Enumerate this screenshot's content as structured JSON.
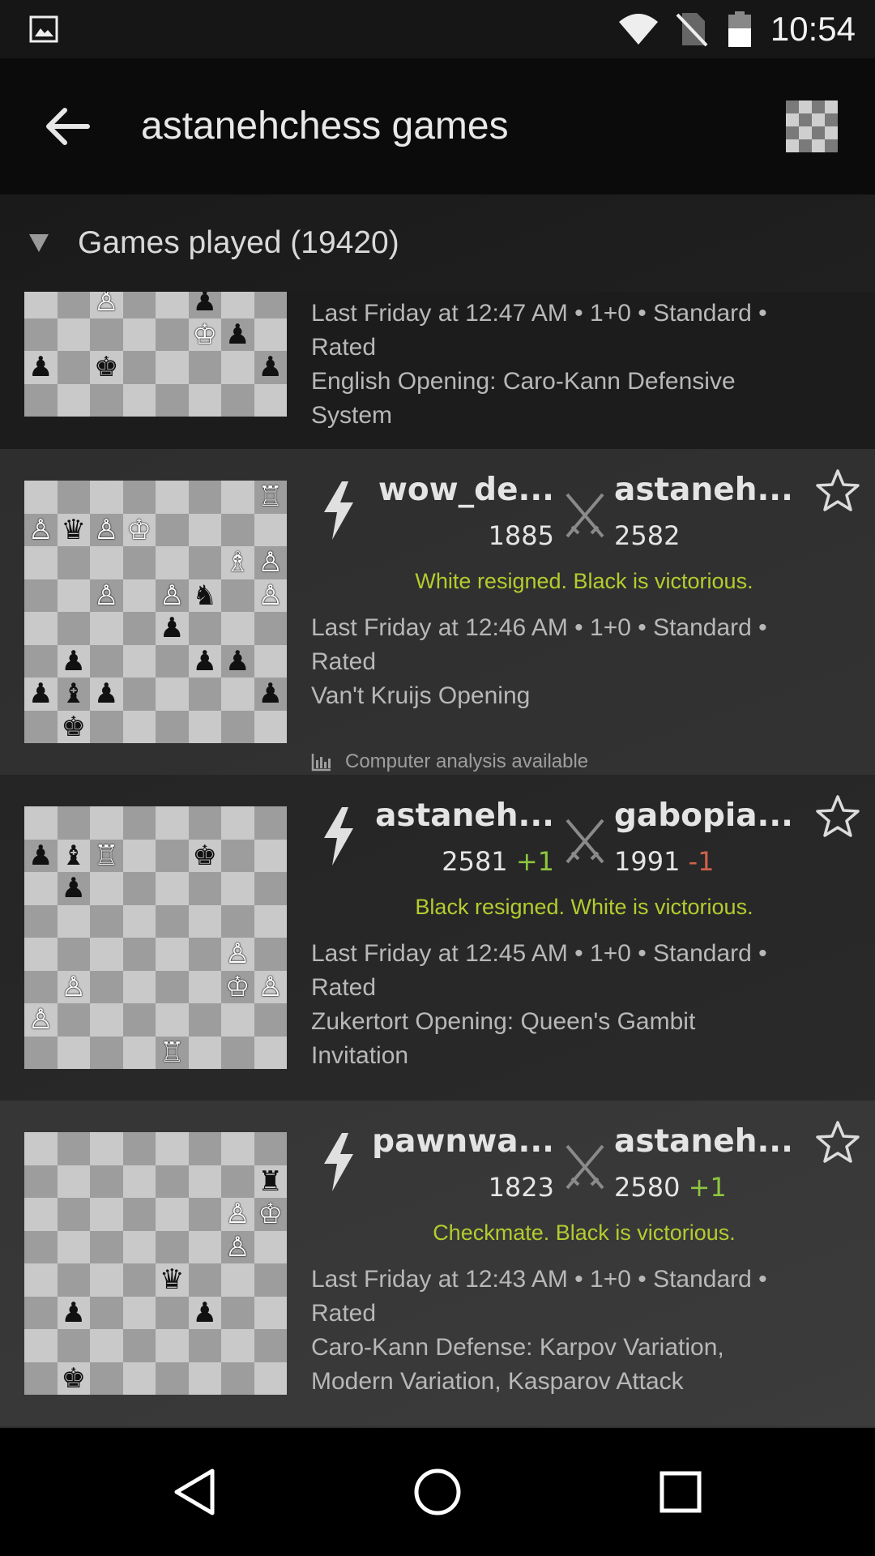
{
  "status_bar": {
    "time": "10:54",
    "icons": [
      "image-icon",
      "wifi-icon",
      "no-sim-icon",
      "battery-icon"
    ]
  },
  "app_bar": {
    "title": "astanehchess games",
    "back_icon": "arrow-left-icon",
    "board_icon": "checkerboard-icon"
  },
  "section": {
    "title": "Games played (19420)"
  },
  "games": [
    {
      "meta": "Last Friday at 12:47 AM • 1+0 • Standard • Rated",
      "opening": "English Opening: Caro-Kann Defensive System"
    },
    {
      "white_name": "wow_de...",
      "white_rating": "1885",
      "white_diff": "",
      "black_name": "astaneh...",
      "black_rating": "2582",
      "black_diff": "",
      "result": "White resigned. Black is victorious.",
      "meta": "Last Friday at 12:46 AM • 1+0 • Standard • Rated",
      "opening": "Van't Kruijs Opening",
      "analysis": "Computer analysis available"
    },
    {
      "white_name": "astaneh...",
      "white_rating": "2581",
      "white_diff": "+1",
      "black_name": "gabopia...",
      "black_rating": "1991",
      "black_diff": "-1",
      "result": "Black resigned. White is victorious.",
      "meta": "Last Friday at 12:45 AM • 1+0 • Standard • Rated",
      "opening": "Zukertort Opening: Queen's Gambit Invitation"
    },
    {
      "white_name": "pawnwa...",
      "white_rating": "1823",
      "white_diff": "",
      "black_name": "astaneh...",
      "black_rating": "2580",
      "black_diff": "+1",
      "result": "Checkmate. Black is victorious.",
      "meta": "Last Friday at 12:43 AM • 1+0 • Standard • Rated",
      "opening": "Caro-Kann Defense: Karpov Variation, Modern Variation, Kasparov Attack"
    }
  ],
  "boards": [
    [
      "........",
      "........",
      "........",
      "........",
      "..P..p..",
      ".....Kp.",
      "p.k....p",
      "........"
    ],
    [
      ".......R",
      "PqPK....",
      "......BP",
      "..P.Pn.P",
      "....p...",
      ".p...pp.",
      "pbp....p",
      ".k......"
    ],
    [
      "........",
      "pbR..k..",
      ".p......",
      "........",
      "......P.",
      ".P....KP",
      "P.......",
      "....R..."
    ],
    [
      "........",
      ".......r",
      "......PK",
      "......P.",
      "....q...",
      ".p...p..",
      "........",
      ".k......"
    ]
  ],
  "nav_bar": {
    "buttons": [
      "back-triangle-icon",
      "home-circle-icon",
      "recents-square-icon"
    ]
  },
  "colors": {
    "result_text": "#b5cc2e",
    "positive_diff": "#8ec63f",
    "negative_diff": "#d0624a"
  }
}
